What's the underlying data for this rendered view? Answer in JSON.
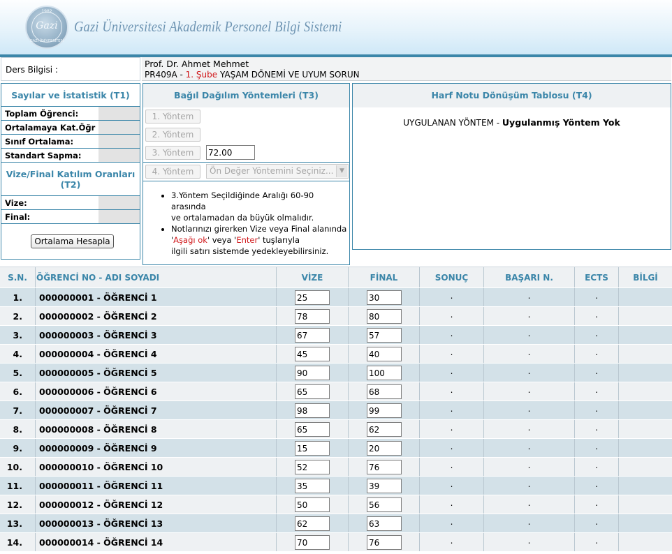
{
  "header": {
    "title": "Gazi Üniversitesi Akademik Personel Bilgi Sistemi",
    "logo": {
      "year": "1982",
      "mark": "Gazi",
      "bottom": "GAZİ ÜNİVERSİTESİ"
    }
  },
  "course": {
    "label": "Ders Bilgisi :",
    "instructor": "Prof. Dr. Ahmet Mehmet",
    "code": "PR409A - ",
    "section": "1. Şube",
    "name": " YAŞAM DÖNEMİ VE UYUM SORUN"
  },
  "stats": {
    "title": "Sayılar ve İstatistik (T1)",
    "rows": [
      {
        "label": "Toplam Öğrenci:",
        "value": ""
      },
      {
        "label": "Ortalamaya Kat.Öğr :",
        "value": ""
      },
      {
        "label": "Sınıf Ortalama:",
        "value": ""
      },
      {
        "label": "Standart Sapma:",
        "value": ""
      }
    ],
    "participation_title": "Vize/Final Katılım Oranları (T2)",
    "participation": [
      {
        "label": "Vize:",
        "value": ""
      },
      {
        "label": "Final:",
        "value": ""
      }
    ],
    "button": "Ortalama Hesapla"
  },
  "methods": {
    "title": "Bağıl Dağılım Yöntemleri (T3)",
    "buttons": [
      "1. Yöntem",
      "2. Yöntem",
      "3. Yöntem",
      "4. Yöntem"
    ],
    "method3_value": "72.00",
    "method4_select": "Ön Değer Yöntemini Seçiniz...",
    "note1_a": "3.Yöntem Seçildiğinde Aralığı 60-90 arasında",
    "note1_b": "ve ortalamadan da büyük olmalıdır.",
    "note2_a": "Notlarınızı girerken Vize veya Final alanında '",
    "note2_key1": "Aşağı ok",
    "note2_b": "' veya '",
    "note2_key2": "Enter",
    "note2_c": "' tuşlarıyla",
    "note2_d": "ilgili satırı sistemde yedekleyebilirsiniz."
  },
  "letter_table": {
    "title": "Harf Notu Dönüşüm Tablosu (T4)",
    "applied_label": "UYGULANAN YÖNTEM - ",
    "applied_value": "Uygulanmış Yöntem Yok"
  },
  "table": {
    "headers": [
      "S.N.",
      "ÖĞRENCİ NO - ADI SOYADI",
      "VİZE",
      "FİNAL",
      "SONUÇ",
      "BAŞARI N.",
      "ECTS",
      "BİLGİ"
    ],
    "rows": [
      {
        "sn": "1.",
        "name": "000000001 - ÖĞRENCİ 1",
        "vize": "25",
        "final": "30",
        "sonuc": ".",
        "basari": ".",
        "ects": ".",
        "bilgi": ""
      },
      {
        "sn": "2.",
        "name": "000000002 - ÖĞRENCİ 2",
        "vize": "78",
        "final": "80",
        "sonuc": ".",
        "basari": ".",
        "ects": ".",
        "bilgi": ""
      },
      {
        "sn": "3.",
        "name": "000000003 - ÖĞRENCİ 3",
        "vize": "67",
        "final": "57",
        "sonuc": ".",
        "basari": ".",
        "ects": ".",
        "bilgi": ""
      },
      {
        "sn": "4.",
        "name": "000000004 - ÖĞRENCİ 4",
        "vize": "45",
        "final": "40",
        "sonuc": ".",
        "basari": ".",
        "ects": ".",
        "bilgi": ""
      },
      {
        "sn": "5.",
        "name": "000000005 - ÖĞRENCİ 5",
        "vize": "90",
        "final": "100",
        "sonuc": ".",
        "basari": ".",
        "ects": ".",
        "bilgi": ""
      },
      {
        "sn": "6.",
        "name": "000000006 - ÖĞRENCİ 6",
        "vize": "65",
        "final": "68",
        "sonuc": ".",
        "basari": ".",
        "ects": ".",
        "bilgi": ""
      },
      {
        "sn": "7.",
        "name": "000000007 - ÖĞRENCİ 7",
        "vize": "98",
        "final": "99",
        "sonuc": ".",
        "basari": ".",
        "ects": ".",
        "bilgi": ""
      },
      {
        "sn": "8.",
        "name": "000000008 - ÖĞRENCİ 8",
        "vize": "65",
        "final": "62",
        "sonuc": ".",
        "basari": ".",
        "ects": ".",
        "bilgi": ""
      },
      {
        "sn": "9.",
        "name": "000000009 - ÖĞRENCİ 9",
        "vize": "15",
        "final": "20",
        "sonuc": ".",
        "basari": ".",
        "ects": ".",
        "bilgi": ""
      },
      {
        "sn": "10.",
        "name": "000000010 - ÖĞRENCİ 10",
        "vize": "52",
        "final": "76",
        "sonuc": ".",
        "basari": ".",
        "ects": ".",
        "bilgi": ""
      },
      {
        "sn": "11.",
        "name": "000000011 - ÖĞRENCİ 11",
        "vize": "35",
        "final": "39",
        "sonuc": ".",
        "basari": ".",
        "ects": ".",
        "bilgi": ""
      },
      {
        "sn": "12.",
        "name": "000000012 - ÖĞRENCİ 12",
        "vize": "50",
        "final": "56",
        "sonuc": ".",
        "basari": ".",
        "ects": ".",
        "bilgi": ""
      },
      {
        "sn": "13.",
        "name": "000000013 - ÖĞRENCİ 13",
        "vize": "62",
        "final": "63",
        "sonuc": ".",
        "basari": ".",
        "ects": ".",
        "bilgi": ""
      },
      {
        "sn": "14.",
        "name": "000000014 - ÖĞRENCİ 14",
        "vize": "70",
        "final": "76",
        "sonuc": ".",
        "basari": ".",
        "ects": ".",
        "bilgi": ""
      }
    ]
  },
  "colors": {
    "accent": "#3b86a9",
    "row_odd": "#d3e1e8",
    "row_even": "#eef1f3",
    "highlight": "#d0171a"
  }
}
